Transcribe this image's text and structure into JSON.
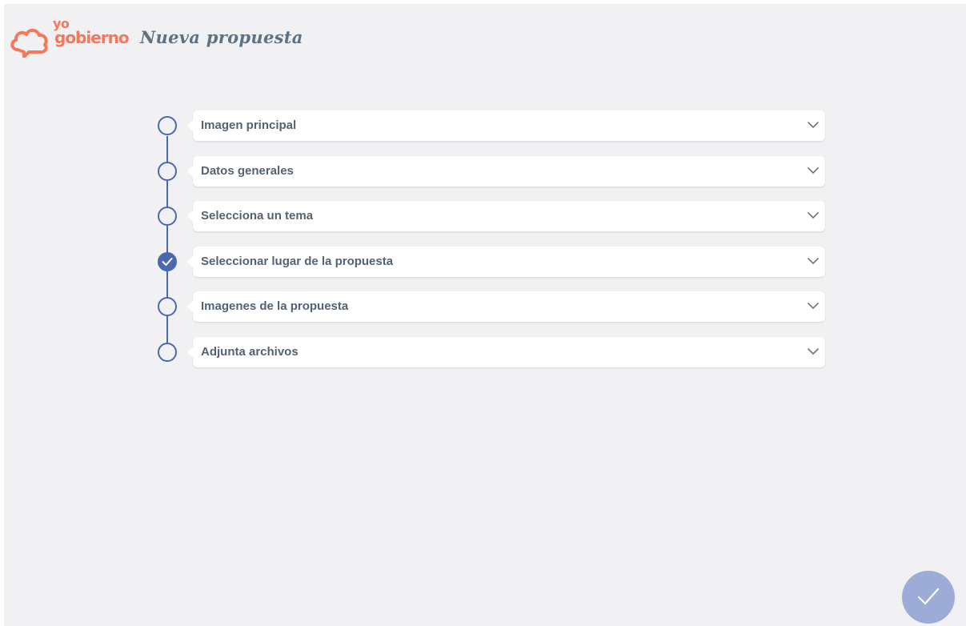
{
  "header": {
    "logo_top": "yo",
    "logo_bottom": "gobierno",
    "title": "Nueva propuesta"
  },
  "steps": [
    {
      "label": "Imagen principal",
      "completed": false
    },
    {
      "label": "Datos generales",
      "completed": false
    },
    {
      "label": "Selecciona un tema",
      "completed": false
    },
    {
      "label": "Seleccionar lugar de la propuesta",
      "completed": true
    },
    {
      "label": "Imagenes de la propuesta",
      "completed": false
    },
    {
      "label": "Adjunta archivos",
      "completed": false
    }
  ],
  "icons": {
    "logo": "cloud-chat-logo-icon",
    "expand": "chevron-down-icon",
    "done": "check-icon",
    "submit": "check-icon"
  },
  "colors": {
    "background": "#f1f1f4",
    "brand": "#f7775b",
    "accent": "#4b67b0",
    "fab": "#9dabd7",
    "title": "#5d7184",
    "label": "#556270"
  }
}
